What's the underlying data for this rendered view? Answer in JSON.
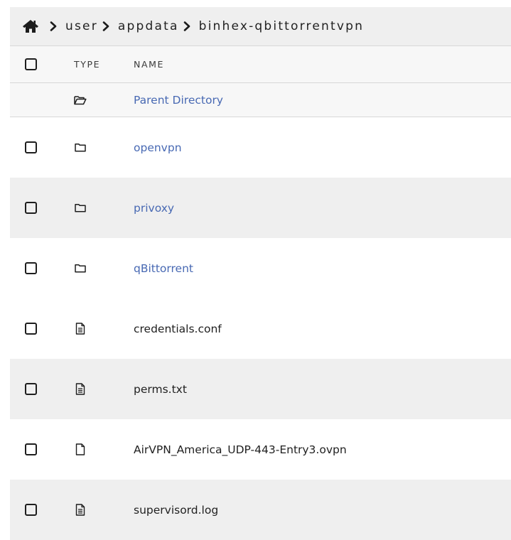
{
  "breadcrumb": {
    "home_icon": "home-icon",
    "separator_icon": "chevron-right-icon",
    "items": [
      "user",
      "appdata",
      "binhex-qbittorrentvpn"
    ]
  },
  "table": {
    "headers": {
      "type": "TYPE",
      "name": "NAME"
    },
    "parent": {
      "icon": "folder-open-icon",
      "label": "Parent Directory"
    },
    "rows": [
      {
        "icon": "folder-icon",
        "name": "openvpn",
        "kind": "folder"
      },
      {
        "icon": "folder-icon",
        "name": "privoxy",
        "kind": "folder"
      },
      {
        "icon": "folder-icon",
        "name": "qBittorrent",
        "kind": "folder"
      },
      {
        "icon": "text-file-icon",
        "name": "credentials.conf",
        "kind": "file"
      },
      {
        "icon": "text-file-icon",
        "name": "perms.txt",
        "kind": "file"
      },
      {
        "icon": "blank-file-icon",
        "name": "AirVPN_America_UDP-443-Entry3.ovpn",
        "kind": "file"
      },
      {
        "icon": "text-file-icon",
        "name": "supervisord.log",
        "kind": "file"
      }
    ]
  },
  "colors": {
    "link": "#4869b3",
    "header_bg": "#efefef",
    "alt_row_bg": "#efefef",
    "border": "#d8d8d8"
  }
}
